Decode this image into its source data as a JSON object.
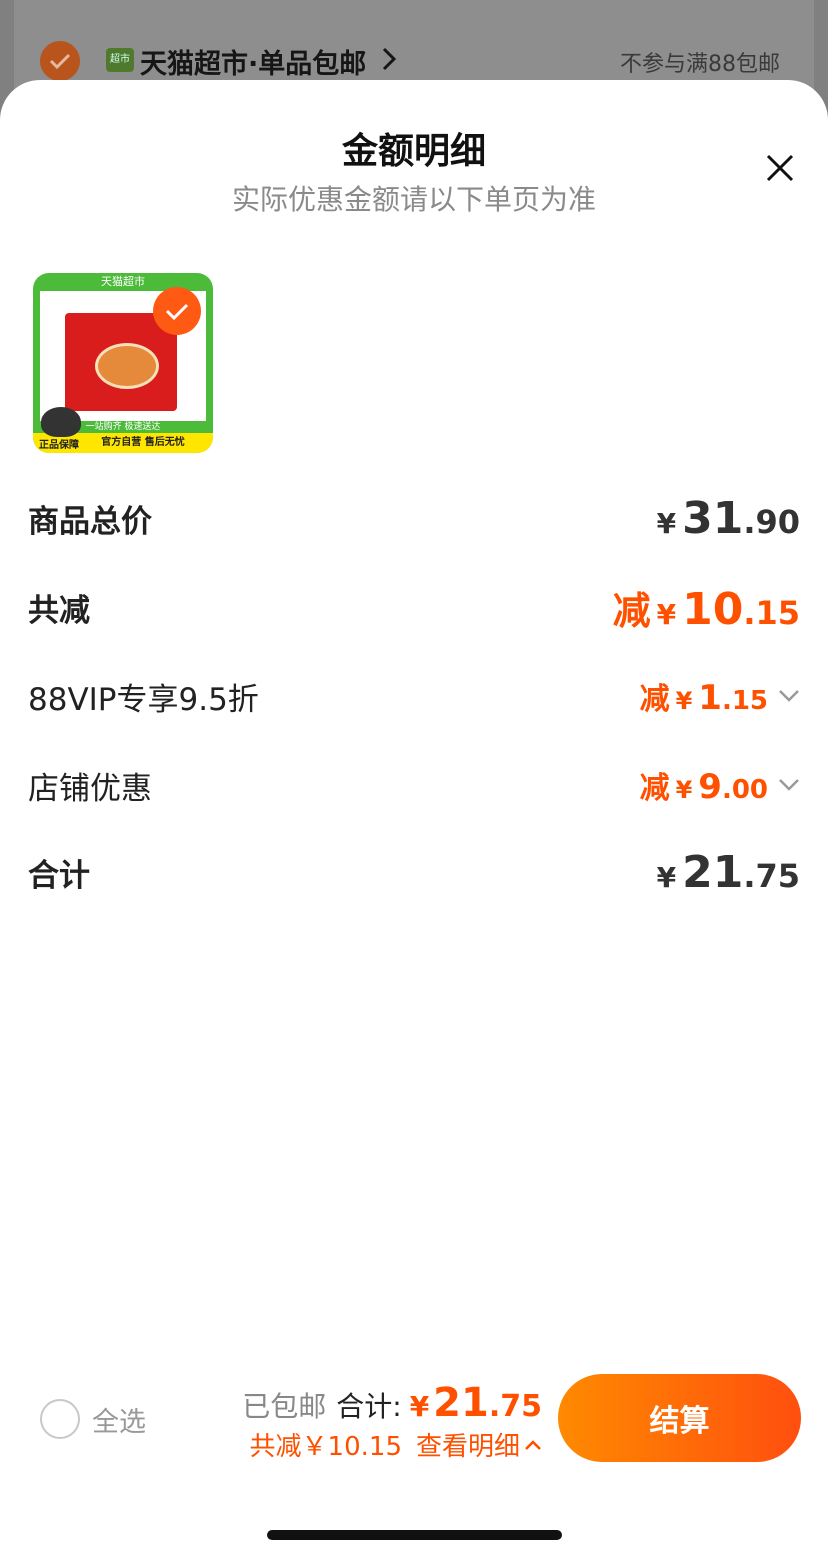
{
  "background": {
    "store_name": "天猫超市·单品包邮",
    "store_logo_text": "超市",
    "shipping_note": "不参与满88包邮"
  },
  "sheet": {
    "title": "金额明细",
    "subtitle": "实际优惠金额请以下单页为准",
    "close_icon": "close-icon"
  },
  "product": {
    "top_label": "天猫超市",
    "band_text": "一站购齐 极速送达",
    "badge_text": "官方自营 售后无忧",
    "guarantee_text": "正品保障",
    "selected": true
  },
  "rows": {
    "subtotal": {
      "label": "商品总价",
      "currency": "¥",
      "int": "31",
      "dec": ".90"
    },
    "total_discount": {
      "label": "共减",
      "prefix": "减",
      "currency": "¥",
      "int": "10",
      "dec": ".15"
    },
    "vip_discount": {
      "label": "88VIP专享9.5折",
      "prefix": "减",
      "currency": "¥",
      "int": "1",
      "dec": ".15"
    },
    "store_discount": {
      "label": "店铺优惠",
      "prefix": "减",
      "currency": "¥",
      "int": "9",
      "dec": ".00"
    },
    "total": {
      "label": "合计",
      "currency": "¥",
      "int": "21",
      "dec": ".75"
    }
  },
  "bottom_bar": {
    "select_all_label": "全选",
    "shipping_status": "已包邮",
    "total_label": "合计:",
    "currency": "¥",
    "total_int": "21",
    "total_dec": ".75",
    "discount_text": "共减￥10.15",
    "detail_link": "查看明细",
    "checkout_label": "结算"
  },
  "colors": {
    "accent": "#ff5000",
    "checkout_gradient_start": "#ff8a00",
    "checkout_gradient_end": "#ff4f0f"
  }
}
